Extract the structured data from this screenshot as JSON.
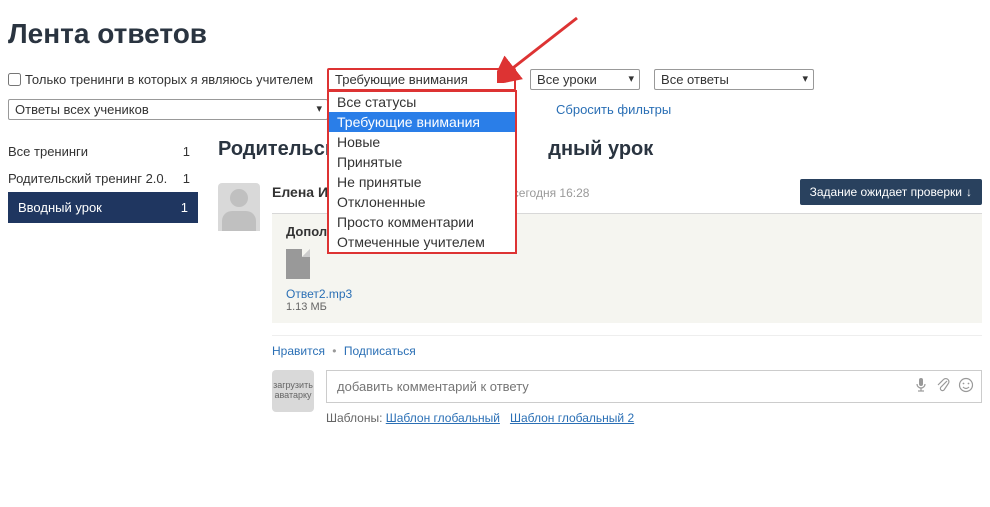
{
  "page_title": "Лента ответов",
  "filters": {
    "teacher_checkbox_label": "Только тренинги в которых я являюсь учителем",
    "status_select": "Требующие внимания",
    "lessons_select": "Все уроки",
    "answers_select": "Все ответы",
    "students_select": "Ответы всех учеников",
    "reset_label": "Сбросить фильтры",
    "status_options": [
      "Все статусы",
      "Требующие внимания",
      "Новые",
      "Принятые",
      "Не принятые",
      "Отклоненные",
      "Просто комментарии",
      "Отмеченные учителем"
    ],
    "status_selected_index": 1
  },
  "sidebar": {
    "items": [
      {
        "label": "Все тренинги",
        "count": "1",
        "active": false
      },
      {
        "label": "Родительский тренинг 2.0.",
        "count": "1",
        "active": false
      },
      {
        "label": "Вводный урок",
        "count": "1",
        "active": true
      }
    ]
  },
  "content": {
    "breadcrumb_prefix": "Родительски",
    "breadcrumb_suffix": "дный урок",
    "answer": {
      "author": "Елена Ив",
      "created_label": "здан сегодня 16:28",
      "status_badge": "Задание ожидает проверки",
      "attach_header_prefix": "Дополн",
      "attach_header_suffix": "в",
      "file_name": "Ответ2.mp3",
      "file_size": "1.13 МБ",
      "like_label": "Нравится",
      "subscribe_label": "Подписаться",
      "comment_placeholder": "добавить комментарий к ответу",
      "avatar_upload_label": "загрузить аватарку",
      "templates_prefix": "Шаблоны:",
      "template_links": [
        "Шаблон глобальный",
        "Шаблон глобальный 2"
      ]
    }
  }
}
